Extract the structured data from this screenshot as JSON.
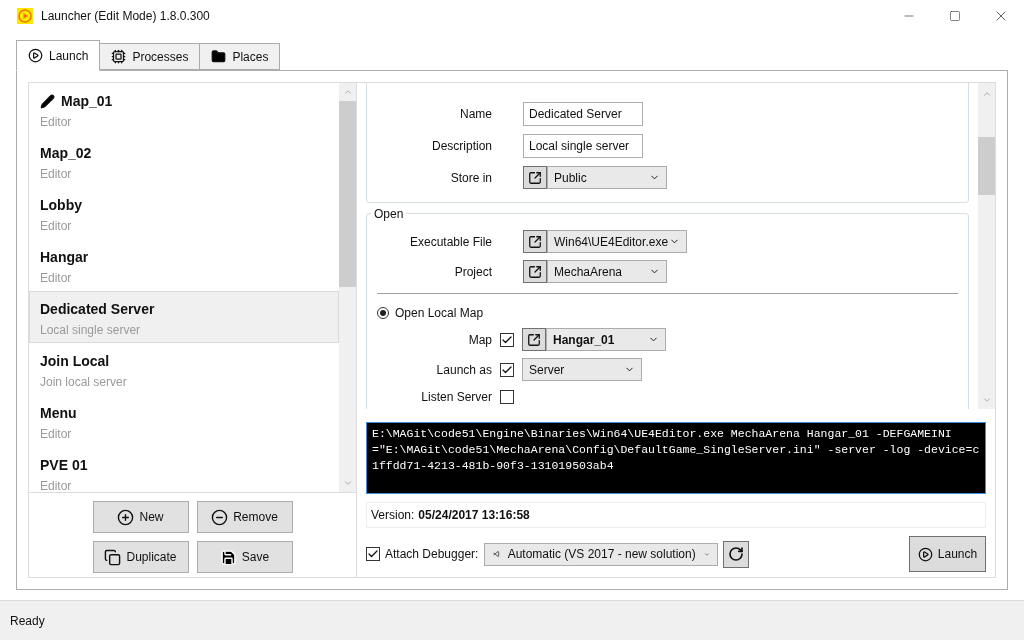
{
  "window": {
    "title": "Launcher (Edit Mode) 1.8.0.300"
  },
  "tabs": [
    {
      "label": "Launch",
      "selected": true
    },
    {
      "label": "Processes",
      "selected": false
    },
    {
      "label": "Places",
      "selected": false
    }
  ],
  "profiles": [
    {
      "name": "Map_01",
      "subtitle": "Editor",
      "editing": true,
      "selected": false
    },
    {
      "name": "Map_02",
      "subtitle": "Editor",
      "editing": false,
      "selected": false
    },
    {
      "name": "Lobby",
      "subtitle": "Editor",
      "editing": false,
      "selected": false
    },
    {
      "name": "Hangar",
      "subtitle": "Editor",
      "editing": false,
      "selected": false
    },
    {
      "name": "Dedicated Server",
      "subtitle": "Local single server",
      "editing": false,
      "selected": true
    },
    {
      "name": "Join Local",
      "subtitle": "Join local server",
      "editing": false,
      "selected": false
    },
    {
      "name": "Menu",
      "subtitle": "Editor",
      "editing": false,
      "selected": false
    },
    {
      "name": "PVE 01",
      "subtitle": "Editor",
      "editing": false,
      "selected": false
    }
  ],
  "list_buttons": [
    {
      "label": "New"
    },
    {
      "label": "Remove"
    },
    {
      "label": "Duplicate"
    },
    {
      "label": "Save"
    }
  ],
  "profile": {
    "fields": [
      {
        "label": "Name",
        "kind": "text",
        "value": "Dedicated Server"
      },
      {
        "label": "Description",
        "kind": "text",
        "value": "Local single server"
      },
      {
        "label": "Store in",
        "kind": "link-dropdown",
        "value": "Public"
      }
    ]
  },
  "open": {
    "title": "Open",
    "fields": [
      {
        "label": "Executable File",
        "kind": "link-dropdown",
        "value": "Win64\\UE4Editor.exe"
      },
      {
        "label": "Project",
        "kind": "link-dropdown",
        "value": "MechaArena"
      }
    ],
    "mode": {
      "label": "Open Local Map",
      "selected": true
    },
    "options": [
      {
        "label": "Map",
        "checked": true,
        "kind": "link-dropdown",
        "value": "Hangar_01",
        "bold": true
      },
      {
        "label": "Launch as",
        "checked": true,
        "kind": "dropdown",
        "value": "Server",
        "bold": false
      },
      {
        "label": "Listen Server",
        "checked": false,
        "kind": "checkbox"
      }
    ]
  },
  "command_line": "E:\\MAGit\\code51\\Engine\\Binaries\\Win64\\UE4Editor.exe MechaArena Hangar_01 -DEFGAMEINI=\"E:\\MAGit\\code51\\MechaArena\\Config\\DefaultGame_SingleServer.ini\" -server -log -device=c1ffdd71-4213-481b-90f3-131019503ab4",
  "version": {
    "label": "Version:",
    "value": "05/24/2017 13:16:58"
  },
  "debugger": {
    "label": "Attach Debugger:",
    "checked": true,
    "value": "Automatic (VS 2017 - new solution)"
  },
  "launch_button": "Launch",
  "status_bar": "Ready"
}
